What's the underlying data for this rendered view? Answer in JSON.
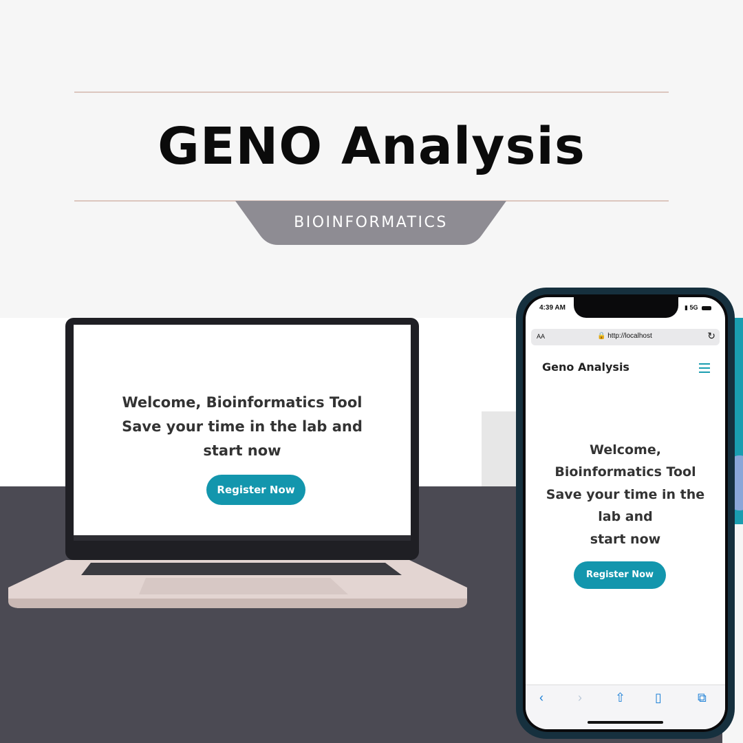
{
  "banner": {
    "title": "GENO Analysis",
    "tag": "BIOINFORMATICS"
  },
  "colors": {
    "accent": "#1396ad",
    "tag_bg": "#8e8c93",
    "rule": "#dcc6be",
    "floor": "#4b4a53"
  },
  "laptop": {
    "hero_line1": "Welcome, Bioinformatics Tool",
    "hero_line2": "Save your time in the lab and",
    "hero_line3": "start now",
    "register_label": "Register Now"
  },
  "phone": {
    "status_time": "4:39 AM",
    "status_network": "5G",
    "url_text_size": "AA",
    "url": "http://localhost",
    "brand": "Geno Analysis",
    "hero_lines": [
      "Welcome,",
      "Bioinformatics Tool",
      "Save your time in the",
      "lab and",
      "start now"
    ],
    "register_label": "Register Now",
    "toolbar_icons": [
      "back-icon",
      "forward-icon",
      "share-icon",
      "bookmarks-icon",
      "tabs-icon"
    ]
  }
}
